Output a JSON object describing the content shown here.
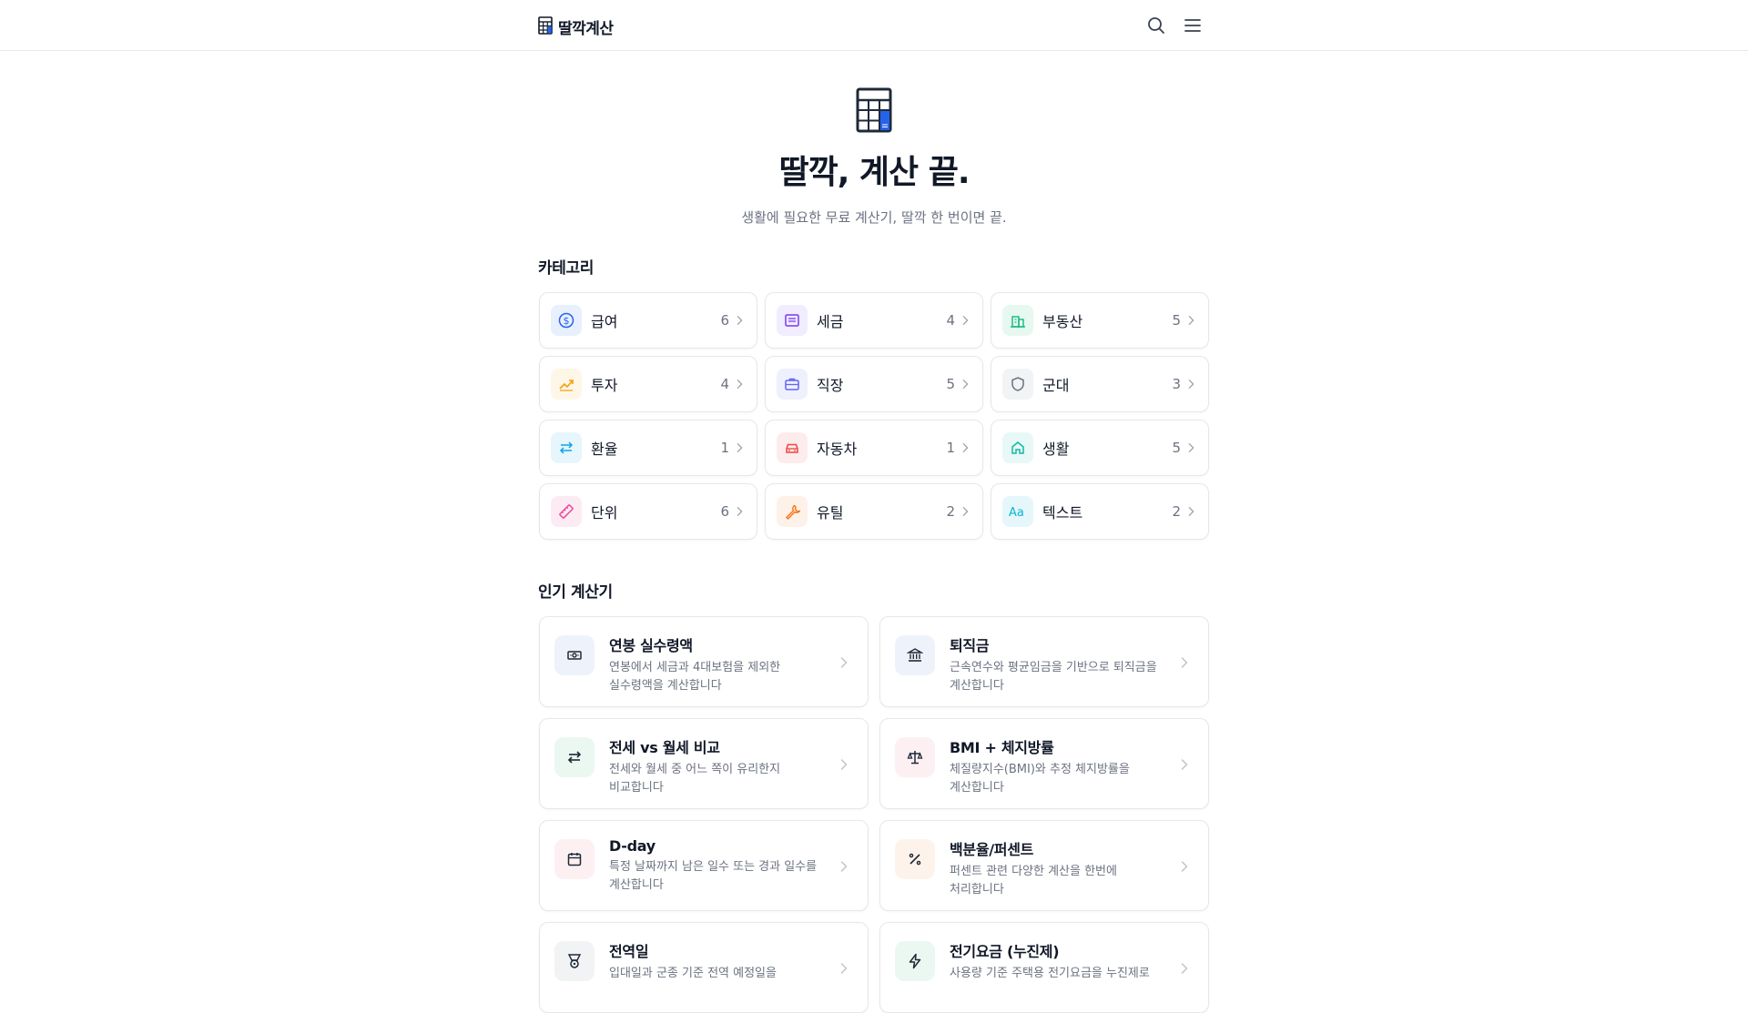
{
  "header": {
    "logo_text": "딸깍계산"
  },
  "hero": {
    "title": "딸깍, 계산 끝.",
    "subtitle": "생활에 필요한 무료 계산기, 딸깍 한 번이면 끝."
  },
  "categories": {
    "title": "카테고리",
    "items": [
      {
        "label": "급여",
        "count": "6",
        "icon": "dollar-icon",
        "color": "#2563eb",
        "bg": "#e8f0fe"
      },
      {
        "label": "세금",
        "count": "4",
        "icon": "receipt-icon",
        "color": "#7c3aed",
        "bg": "#f1ecfe"
      },
      {
        "label": "부동산",
        "count": "5",
        "icon": "building-icon",
        "color": "#10b981",
        "bg": "#e7f8f1"
      },
      {
        "label": "투자",
        "count": "4",
        "icon": "chart-up-icon",
        "color": "#f59e0b",
        "bg": "#fef6e7"
      },
      {
        "label": "직장",
        "count": "5",
        "icon": "briefcase-icon",
        "color": "#6366f1",
        "bg": "#eef0fe"
      },
      {
        "label": "군대",
        "count": "3",
        "icon": "shield-icon",
        "color": "#6b7280",
        "bg": "#f1f3f5"
      },
      {
        "label": "환율",
        "count": "1",
        "icon": "exchange-icon",
        "color": "#0ea5e9",
        "bg": "#e7f5fc"
      },
      {
        "label": "자동차",
        "count": "1",
        "icon": "car-icon",
        "color": "#ef4444",
        "bg": "#fdecec"
      },
      {
        "label": "생활",
        "count": "5",
        "icon": "home-icon",
        "color": "#14b8a6",
        "bg": "#e7f8f6"
      },
      {
        "label": "단위",
        "count": "6",
        "icon": "ruler-icon",
        "color": "#ec4899",
        "bg": "#fdebf4"
      },
      {
        "label": "유틸",
        "count": "2",
        "icon": "wrench-icon",
        "color": "#f97316",
        "bg": "#fef1e8"
      },
      {
        "label": "텍스트",
        "count": "2",
        "icon": "text-icon",
        "color": "#06b6d4",
        "bg": "#e6f7fb"
      }
    ]
  },
  "popular": {
    "title": "인기 계산기",
    "items": [
      {
        "title": "연봉 실수령액",
        "desc1": "연봉에서 세금과 4대보험을 제외한",
        "desc2": "실수령액을 계산합니다",
        "icon": "money-icon",
        "color": "#1f2937",
        "bg": "#eef2fb"
      },
      {
        "title": "퇴직금",
        "desc1": "근속연수와 평균임금을 기반으로 퇴직금을",
        "desc2": "계산합니다",
        "icon": "bank-icon",
        "color": "#1f2937",
        "bg": "#eef2fb"
      },
      {
        "title": "전세 vs 월세 비교",
        "desc1": "전세와 월세 중 어느 쪽이 유리한지",
        "desc2": "비교합니다",
        "icon": "swap-icon",
        "color": "#1f2937",
        "bg": "#eaf8f1"
      },
      {
        "title": "BMI + 체지방률",
        "desc1": "체질량지수(BMI)와 추정 체지방률을",
        "desc2": "계산합니다",
        "icon": "scale-icon",
        "color": "#1f2937",
        "bg": "#fdf0f3"
      },
      {
        "title": "D-day",
        "desc1": "특정 날짜까지 남은 일수 또는 경과 일수를",
        "desc2": "계산합니다",
        "icon": "calendar-icon",
        "color": "#1f2937",
        "bg": "#fdf0f3"
      },
      {
        "title": "백분율/퍼센트",
        "desc1": "퍼센트 관련 다양한 계산을 한번에",
        "desc2": "처리합니다",
        "icon": "percent-icon",
        "color": "#1f2937",
        "bg": "#fef3ea"
      },
      {
        "title": "전역일",
        "desc1": "입대일과 군종 기준 전역 예정일을",
        "desc2": "",
        "icon": "medal-icon",
        "color": "#1f2937",
        "bg": "#f1f3f5"
      },
      {
        "title": "전기요금 (누진제)",
        "desc1": "사용량 기준 주택용 전기요금을 누진제로",
        "desc2": "",
        "icon": "bolt-icon",
        "color": "#1f2937",
        "bg": "#eaf8f1"
      }
    ]
  }
}
